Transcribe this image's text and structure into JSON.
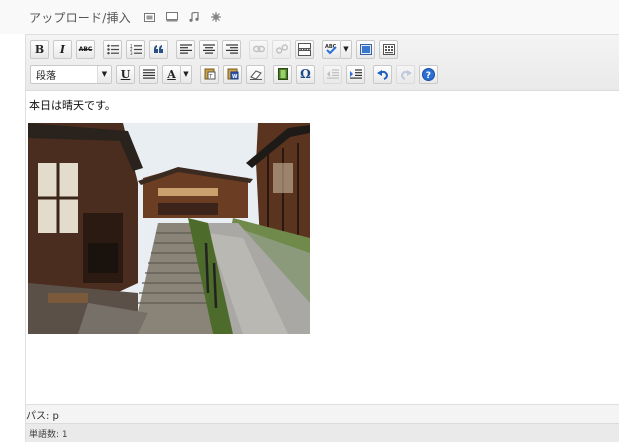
{
  "upload": {
    "label": "アップロード/挿入",
    "icons": [
      "image-upload-icon",
      "video-upload-icon",
      "audio-upload-icon",
      "media-upload-icon"
    ]
  },
  "toolbar": {
    "row1": [
      "bold",
      "italic",
      "strikethrough",
      "bullet-list",
      "numbered-list",
      "blockquote",
      "align-left",
      "align-center",
      "align-right",
      "insert-link",
      "unlink",
      "insert-more",
      "spellcheck",
      "fullscreen",
      "kitchen-sink"
    ],
    "row2": [
      "format-select",
      "underline",
      "justify",
      "text-color",
      "paste-text",
      "paste-word",
      "remove-format",
      "media",
      "special-character",
      "outdent",
      "indent",
      "undo",
      "redo",
      "help"
    ],
    "bold_label": "B",
    "italic_label": "I",
    "strike_label": "ABC",
    "underline_label": "U",
    "text_color_label": "A",
    "omega_label": "Ω",
    "format_value": "段落"
  },
  "content": {
    "paragraph": "本日は晴天です。",
    "image_subject": "hillside village stone path"
  },
  "status": {
    "path": "パス: p",
    "word_count": "単語数: 1"
  },
  "colors": {
    "toolbar_bg": "#efefef",
    "path_bg": "#f4f4f4",
    "word_count_bg": "#eaeaea",
    "help_blue": "#2a6fd6",
    "undo_blue": "#2060c0"
  }
}
